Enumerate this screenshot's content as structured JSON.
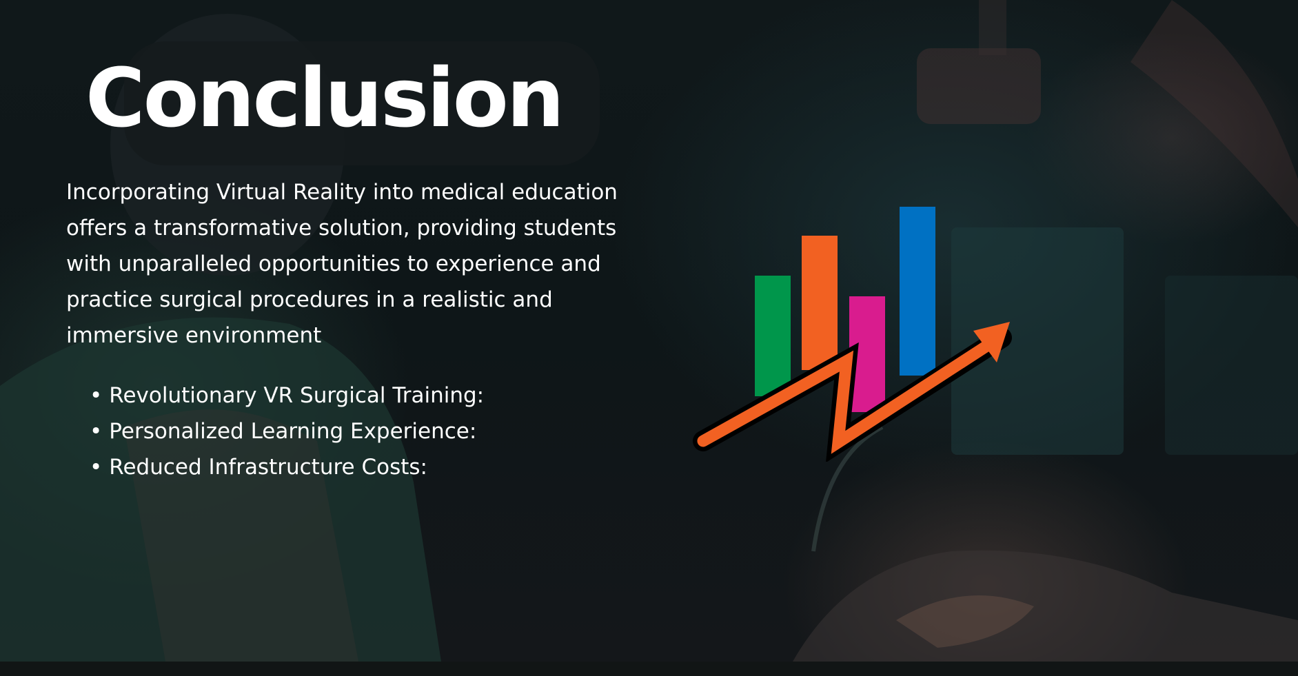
{
  "slide": {
    "title": "Conclusion",
    "intro": "Incorporating Virtual Reality into medical education offers a transformative solution, providing students with unparalleled opportunities to experience and practice surgical procedures in a realistic and immersive environment",
    "bullet_marker": "•",
    "bullets": [
      "Revolutionary VR Surgical Training:",
      "Personalized Learning Experience:",
      "Reduced Infrastructure Costs:"
    ]
  },
  "growth_icon": {
    "icon": "bar-chart-growth-arrow-icon",
    "bar_colors": [
      "#00964B",
      "#F26122",
      "#D91C8E",
      "#0071C3"
    ],
    "arrow_color": "#F26122"
  },
  "background": {
    "description_icon": "surgeon-vr-headset-photo"
  }
}
